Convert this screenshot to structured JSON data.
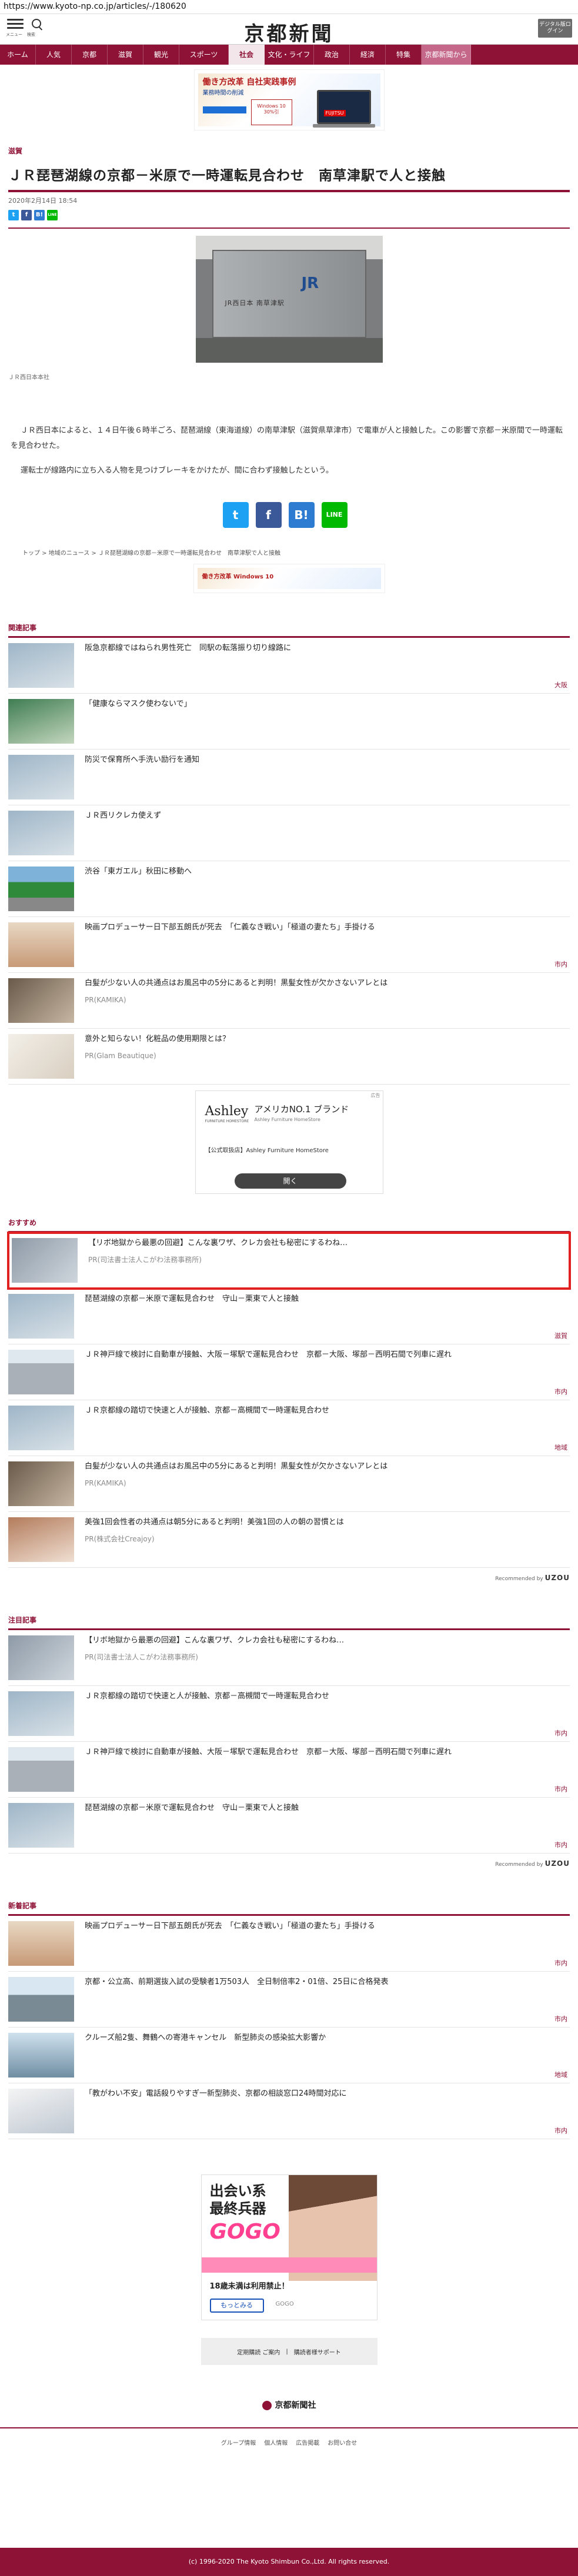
{
  "browser": {
    "url": "https://www.kyoto-np.co.jp/articles/-/180620"
  },
  "header": {
    "menu_label": "メニュー",
    "search_label": "検索",
    "logo": "京都新聞",
    "digital_button": "デジタル版ログイン"
  },
  "nav": {
    "items": [
      {
        "label": "ホーム"
      },
      {
        "label": "人気"
      },
      {
        "label": "京都"
      },
      {
        "label": "滋賀"
      },
      {
        "label": "観光"
      },
      {
        "label": "スポーツ"
      },
      {
        "label": "社会"
      },
      {
        "label": "文化・ライフ"
      },
      {
        "label": "政治"
      },
      {
        "label": "経済"
      },
      {
        "label": "特集"
      },
      {
        "label": "京都新聞から"
      }
    ]
  },
  "ad_top": {
    "headline": "働き方改革 自社実践事例",
    "sub": "業務時間の削減",
    "os": "Windows 10",
    "sale": "30%引",
    "brand": "FUJITSU"
  },
  "article": {
    "category": "滋賀",
    "title": "ＪＲ琵琶湖線の京都－米原で一時運転見合わせ　南草津駅で人と接触",
    "date": "2020年2月14日 18:54",
    "photo_sign_mark": "JR",
    "photo_sign_text": "JR西日本 南草津駅",
    "caption": "ＪＲ西日本本社",
    "paragraphs": [
      "ＪＲ西日本によると、１４日午後６時半ごろ、琵琶湖線（東海道線）の南草津駅（滋賀県草津市）で電車が人と接触した。この影響で京都－米原間で一時運転を見合わせた。",
      "運転士が線路内に立ち入る人物を見つけブレーキをかけたが、間に合わず接触したという。"
    ]
  },
  "share": {
    "twitter_icon": "twitter-icon",
    "facebook_icon": "facebook-icon",
    "hatena_icon": "hatena-icon",
    "line_icon": "line-icon",
    "twitter": "t",
    "facebook": "f",
    "hatena": "B!",
    "line": "LINE"
  },
  "breadcrumb": [
    "トップ",
    "地域のニュース",
    "ＪＲ琵琶湖線の京都－米原で一時運転見合わせ　南草津駅で人と接触"
  ],
  "ad_small": {
    "text": "働き方改革 Windows 10"
  },
  "related": {
    "title": "関連記事",
    "items": [
      {
        "title": "阪急京都線ではねられ男性死亡　同駅の転落振り切り線路に",
        "tag": "大阪",
        "sub": ""
      },
      {
        "title": "「健康ならマスク使わないで」",
        "tag": "",
        "sub": ""
      },
      {
        "title": "防災で保育所へ手洗い励行を通知",
        "tag": "",
        "sub": ""
      },
      {
        "title": "ＪＲ西リクレカ使えず",
        "tag": "",
        "sub": ""
      },
      {
        "title": "渋谷「東ガエル」秋田に移動へ",
        "tag": "",
        "sub": ""
      },
      {
        "title": "映画プロデューサー日下部五朗氏が死去　「仁義なき戦い」「極道の妻たち」手掛ける",
        "tag": "市内",
        "sub": ""
      },
      {
        "title": "白髪が少ない人の共通点はお風呂中の5分にあると判明！黒髪女性が欠かさないアレとは",
        "tag": "",
        "sub": "PR(KAMIKA)"
      },
      {
        "title": "意外と知らない！化粧品の使用期限とは？",
        "tag": "",
        "sub": "PR(Glam Beautique)"
      }
    ]
  },
  "ad_ashley": {
    "ad_label": "広告",
    "logo": "Ashley",
    "logo_sub": "FURNITURE HOMESTORE",
    "line1": "アメリカNO.1 ブランド",
    "line2": "Ashley Furniture HomeStore",
    "line3": "【公式取扱店】Ashley Furniture HomeStore",
    "button": "開く"
  },
  "recommended": {
    "title": "おすすめ",
    "items": [
      {
        "title": "【リボ地獄から最悪の回避】こんな裏ワザ、クレカ会社も秘密にするわね…",
        "tag": "",
        "sub": "PR(司法書士法人こがわ法務事務所)"
      },
      {
        "title": "琵琶湖線の京都－米原で運転見合わせ　守山－栗東で人と接触",
        "tag": "滋賀",
        "sub": ""
      },
      {
        "title": "ＪＲ神戸線で検討に自動車が接触、大阪－塚駅で運転見合わせ　京都－大阪、塚部－西明石間で列車に遅れ",
        "tag": "市内",
        "sub": ""
      },
      {
        "title": "ＪＲ京都線の踏切で快速と人が接触、京都－高槻間で一時運転見合わせ",
        "tag": "地域",
        "sub": ""
      },
      {
        "title": "白髪が少ない人の共通点はお風呂中の5分にあると判明！黒髪女性が欠かさないアレとは",
        "tag": "",
        "sub": "PR(KAMIKA)"
      },
      {
        "title": "美強1回会性者の共通点は朝5分にあると判明！美強1回の人の朝の習慣とは",
        "tag": "",
        "sub": "PR(株式会社Creajoy)"
      }
    ],
    "recommended_by": "Recommended by",
    "brand": "UZOU"
  },
  "attention": {
    "title": "注目記事",
    "items": [
      {
        "title": "【リボ地獄から最悪の回避】こんな裏ワザ、クレカ会社も秘密にするわね…",
        "tag": "",
        "sub": "PR(司法書士法人こがわ法務事務所)"
      },
      {
        "title": "ＪＲ京都線の踏切で快速と人が接触、京都－高槻間で一時運転見合わせ",
        "tag": "市内",
        "sub": ""
      },
      {
        "title": "ＪＲ神戸線で検討に自動車が接触、大阪－塚駅で運転見合わせ　京都－大阪、塚部－西明石間で列車に遅れ",
        "tag": "市内",
        "sub": ""
      },
      {
        "title": "琵琶湖線の京都－米原で運転見合わせ　守山－栗東で人と接触",
        "tag": "市内",
        "sub": ""
      }
    ],
    "recommended_by": "Recommended by",
    "brand": "UZOU"
  },
  "latest": {
    "title": "新着記事",
    "items": [
      {
        "title": "映画プロデューサー日下部五朗氏が死去　「仁義なき戦い」「極道の妻たち」手掛ける",
        "tag": "市内",
        "sub": ""
      },
      {
        "title": "京都・公立高、前期選抜入試の受験者1万503人　全日制倍率2・01倍、25日に合格発表",
        "tag": "市内",
        "sub": ""
      },
      {
        "title": "クルーズ船2隻、舞鶴への寄港キャンセル　新型肺炎の感染拡大影響か",
        "tag": "地域",
        "sub": ""
      },
      {
        "title": "「教がわい不安」電話殺りやすぎ一新型肺炎、京都の相談窓口24時間対応に",
        "tag": "市内",
        "sub": ""
      }
    ]
  },
  "ad_gogo": {
    "line1": "出会い系",
    "line2": "最終兵器",
    "logo": "GOGO",
    "line3": "18歳未満は利用禁止！",
    "button": "もっとみる",
    "brand": "GOGO"
  },
  "footer": {
    "links": [
      "定期購読 ご案内",
      "購読者様サポート"
    ],
    "logo": "京都新聞社",
    "sub_links": [
      "グループ情報",
      "個人情報",
      "広告掲載",
      "お問い合せ"
    ],
    "copyright": "(c) 1996-2020 The Kyoto Shimbun Co.,Ltd. All rights reserved."
  },
  "colors": {
    "brand": "#8e1236",
    "highlight": "#e12121"
  }
}
